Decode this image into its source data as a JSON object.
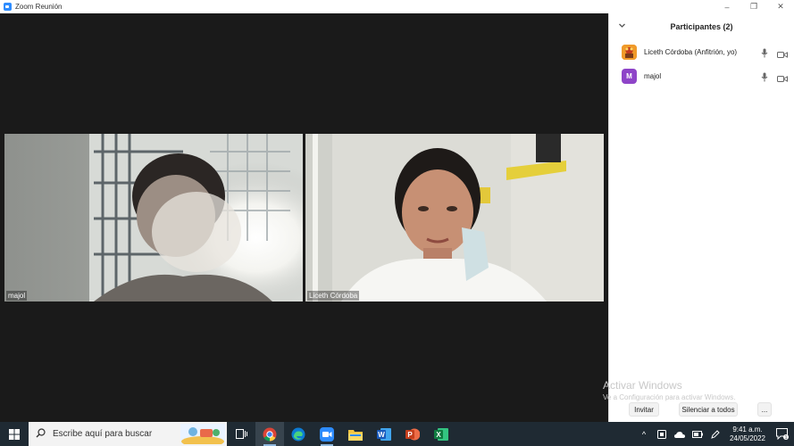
{
  "window": {
    "title": "Zoom Reunión",
    "minimize_glyph": "–",
    "restore_glyph": "❐",
    "close_glyph": "✕"
  },
  "meeting": {
    "tiles": [
      {
        "name": "majol"
      },
      {
        "name": "Liceth Córdoba"
      }
    ]
  },
  "participants_panel": {
    "title": "Participantes (2)",
    "participants": [
      {
        "name": "Liceth Córdoba (Anfitrión, yo)",
        "avatar_type": "image",
        "avatar_color": "#e07b1c",
        "mic_icon": "mic-icon",
        "video_icon": "video-icon"
      },
      {
        "name": "majol",
        "avatar_letter": "M",
        "avatar_color": "#8e44c8",
        "mic_icon": "mic-icon",
        "video_icon": "video-icon"
      }
    ],
    "buttons": {
      "invite": "Invitar",
      "mute_all": "Silenciar a todos",
      "more": "..."
    },
    "watermark_title": "Activar Windows",
    "watermark_sub": "Ve a Configuración para activar Windows."
  },
  "taskbar": {
    "search_placeholder": "Escribe aquí para buscar",
    "apps": [
      {
        "icon": "task-view-icon"
      },
      {
        "icon": "chrome-icon",
        "active": true
      },
      {
        "icon": "edge-icon"
      },
      {
        "icon": "zoom-icon",
        "running": true
      },
      {
        "icon": "file-explorer-icon"
      },
      {
        "icon": "word-icon",
        "label": "W"
      },
      {
        "icon": "powerpoint-icon",
        "label": "P"
      },
      {
        "icon": "excel-icon",
        "label": "X"
      }
    ],
    "clock_time": "9:41 a.m.",
    "clock_date": "24/05/2022",
    "notification_count": "1",
    "tray_chevron": "^"
  },
  "colors": {
    "zoom_blue": "#2d8cff",
    "taskbar_bg": "#1f2a33",
    "panel_bg": "#ffffff",
    "video_bg": "#1a1a1a"
  }
}
